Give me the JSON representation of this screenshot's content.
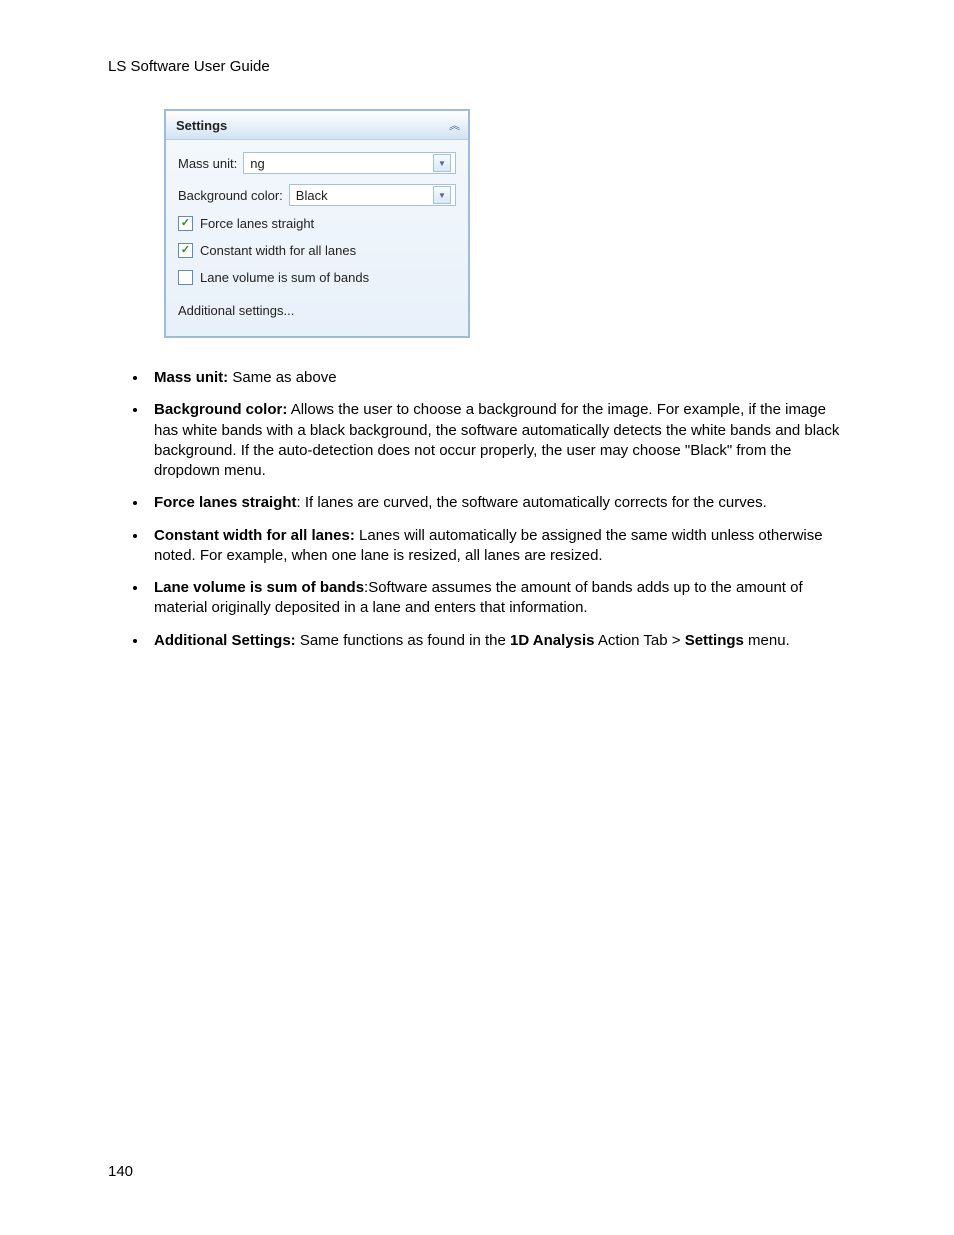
{
  "header": "LS Software User Guide",
  "panel": {
    "title": "Settings",
    "massUnitLabel": "Mass unit:",
    "massUnitValue": "ng",
    "bgColorLabel": "Background color:",
    "bgColorValue": "Black",
    "checkbox1": {
      "checked": true,
      "label": "Force lanes straight"
    },
    "checkbox2": {
      "checked": true,
      "label": "Constant width for all lanes"
    },
    "checkbox3": {
      "checked": false,
      "label": "Lane volume is sum of bands"
    },
    "additional": "Additional settings..."
  },
  "bullets": {
    "b0": {
      "term": "Mass unit:",
      "desc": " Same as above"
    },
    "b1": {
      "term": "Background color:",
      "desc": " Allows the user to choose a background for the image.  For example, if the image has white bands with a black background, the software automatically detects the white bands and black background.  If the auto-detection does not occur properly, the user may choose \"Black\" from the dropdown menu."
    },
    "b2": {
      "term": "Force lanes straight",
      "desc": ": If lanes are curved, the software automatically corrects for the curves."
    },
    "b3": {
      "term": "Constant width for all lanes:",
      "desc": " Lanes will automatically be assigned the same width unless otherwise noted. For example, when one lane is resized, all lanes are resized."
    },
    "b4": {
      "term": "Lane volume is sum of bands",
      "desc": ":Software assumes the amount of bands adds up to the amount of material originally deposited in a lane and enters that information."
    },
    "b5": {
      "term": "Additional Settings:",
      "p1": " Same functions as found in the ",
      "bold1": "1D Analysis",
      "p2": " Action Tab > ",
      "bold2": "Settings",
      "p3": " menu."
    }
  },
  "pageNumber": "140",
  "checkmark": "✓",
  "arrow": "▼"
}
